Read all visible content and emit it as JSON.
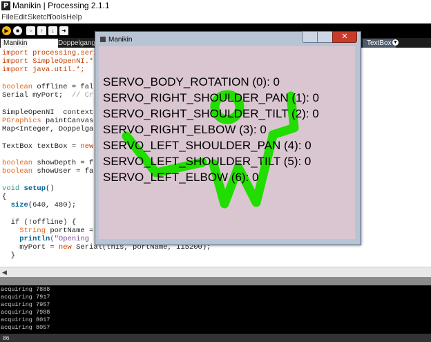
{
  "app": {
    "title": "Manikin | Processing 2.1.1",
    "icon": "P"
  },
  "menu": [
    "File",
    "Edit",
    "Sketch",
    "Tools",
    "Help"
  ],
  "tabs": {
    "active": "Manikin",
    "second": "Doppelganger",
    "right": "TextBox"
  },
  "code": {
    "l1a": "import processing.seri",
    "l2a": "import SimpleOpenNI.*",
    "l3a": "import java.util.*;",
    "l5a": "boolean",
    "l5b": " offline = fal",
    "l6a": "Serial myPort;  ",
    "l6b": "// Cr",
    "l8a": "SimpleOpenNI  context",
    "l9a": "PGraphics",
    "l9b": " paintCanvas",
    "l10a": "Map<Integer, Doppelga",
    "l12a": "TextBox textBox = ",
    "l12b": "new",
    "l14a": "boolean",
    "l14b": " showDepth = f",
    "l15a": "boolean",
    "l15b": " showUser = fa",
    "l17a": "void",
    "l17b": " setup",
    "l17c": "()",
    "l18a": "{",
    "l19a": "  size",
    "l19b": "(640, 480);",
    "l21a": "  if (!offline) {",
    "l22a": "    String",
    "l22b": " portName =",
    "l23a": "    println",
    "l23b": "(\"Opening",
    "l24a": "    myPort = ",
    "l24b": "new",
    "l24c": " Serial(this, portName, 115200);",
    "l25a": "  }"
  },
  "console": [
    "acquiring 7888",
    "acquiring 7917",
    "acquiring 7957",
    "acquiring 7988",
    "acquiring 8017",
    "acquiring 8057"
  ],
  "status": {
    "line": "86"
  },
  "window": {
    "title": "Manikin",
    "close": "✕"
  },
  "servos": [
    "SERVO_BODY_ROTATION (0): 0",
    "SERVO_RIGHT_SHOULDER_PAN (1): 0",
    "SERVO_RIGHT_SHOULDER_TILT (2): 0",
    "SERVO_RIGHT_ELBOW (3): 0",
    "SERVO_LEFT_SHOULDER_PAN (4): 0",
    "SERVO_LEFT_SHOULDER_TILT (5): 0",
    "SERVO_LEFT_ELBOW (6): 0"
  ],
  "colors": {
    "skeleton": "#22dd00",
    "canvas": "#dac6d1",
    "run": "#f3b90d"
  }
}
